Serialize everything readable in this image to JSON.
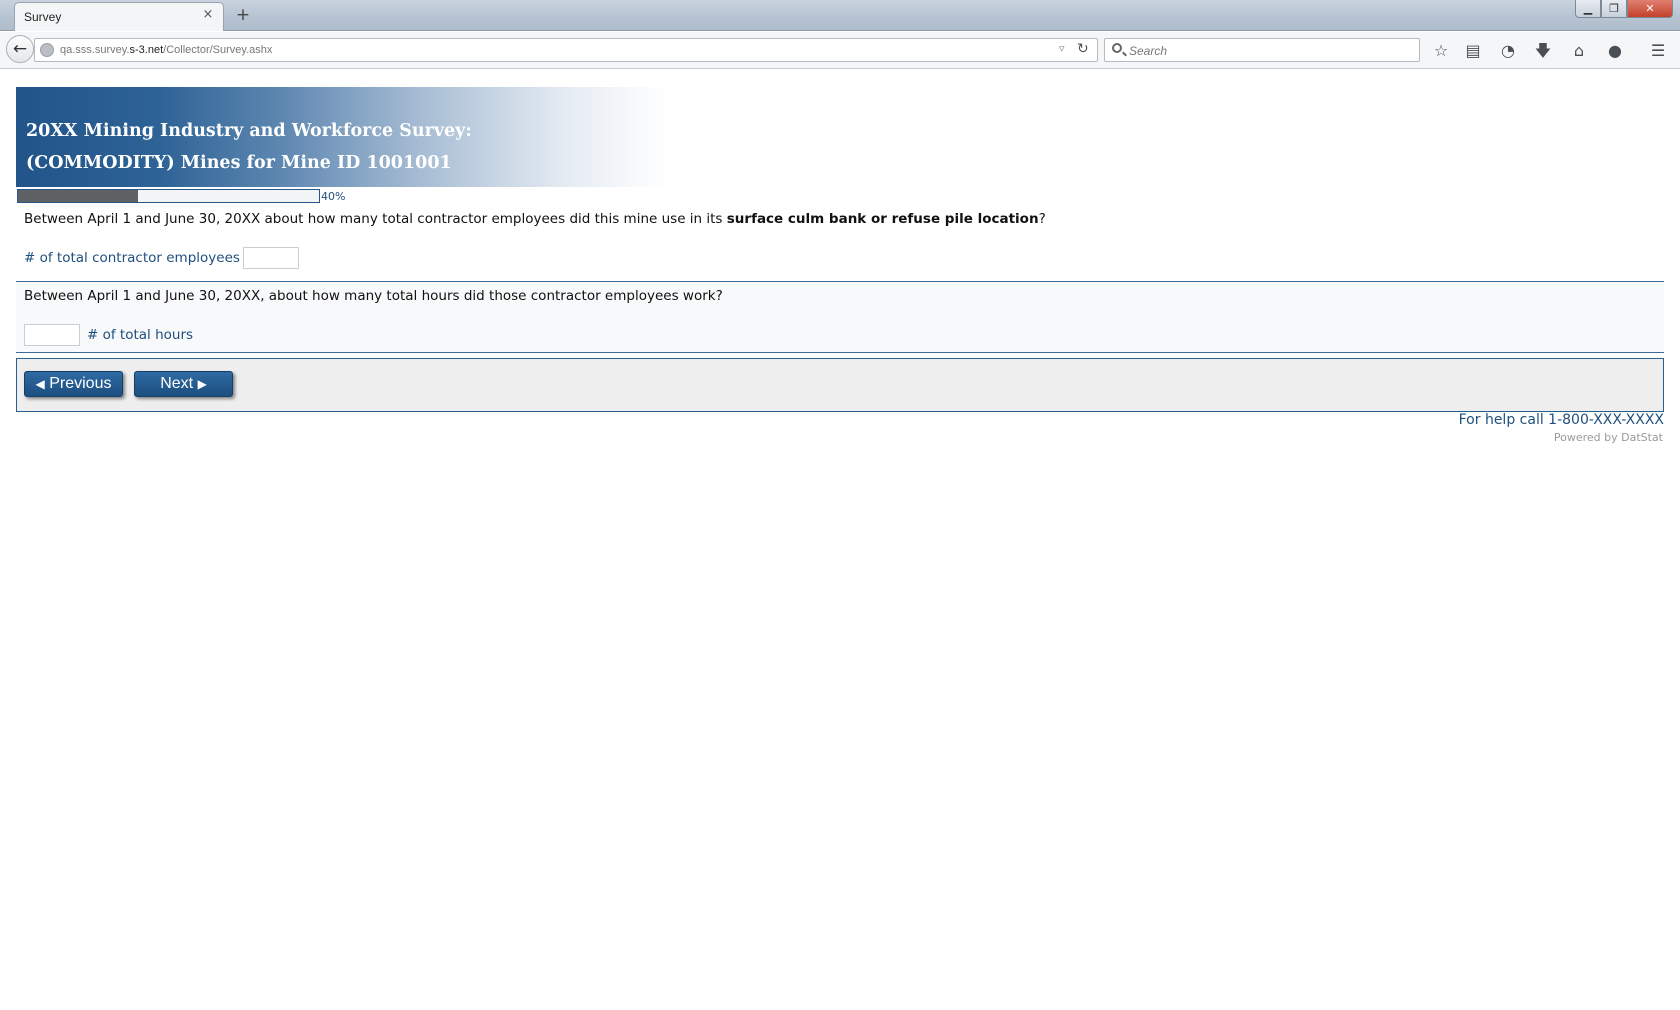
{
  "browser": {
    "tab_title": "Survey",
    "tab_close": "×",
    "new_tab": "+",
    "window_controls": {
      "minimize": "▁",
      "maximize": "❐",
      "close": "✕"
    },
    "url_prefix": "qa.sss.survey.",
    "url_host": "s-3.net",
    "url_path": "/Collector/Survey.ashx",
    "search_placeholder": "Search",
    "icons": [
      "back-icon",
      "globe-icon",
      "reload-icon",
      "search-icon",
      "star-icon",
      "reading-list-icon",
      "pocket-icon",
      "download-icon",
      "home-icon",
      "chat-icon",
      "menu-icon"
    ]
  },
  "survey": {
    "title_line1": "20XX Mining Industry and Workforce Survey:",
    "title_line2": "(COMMODITY) Mines for Mine ID 1001001",
    "progress": {
      "percent": 40,
      "label": "40%"
    },
    "q1": {
      "text_before": "Between April 1 and June 30, 20XX about how many total contractor employees did this mine use in its ",
      "text_bold": "surface culm bank or refuse pile location",
      "text_after": "?",
      "field_label": "# of total contractor employees",
      "value": ""
    },
    "q2": {
      "text": "Between April 1 and June 30, 20XX, about how many total hours did those contractor employees work?",
      "field_label": "# of total hours",
      "value": ""
    },
    "nav": {
      "previous": "Previous",
      "next": "Next"
    },
    "help_text": "For help call 1-800-XXX-XXXX",
    "powered_by": "Powered by DatStat"
  },
  "colors": {
    "brand_blue": "#21558a",
    "link_blue": "#1f4f7e",
    "progress_fill": "#5e6265",
    "nav_panel_bg": "#eeeeee"
  }
}
